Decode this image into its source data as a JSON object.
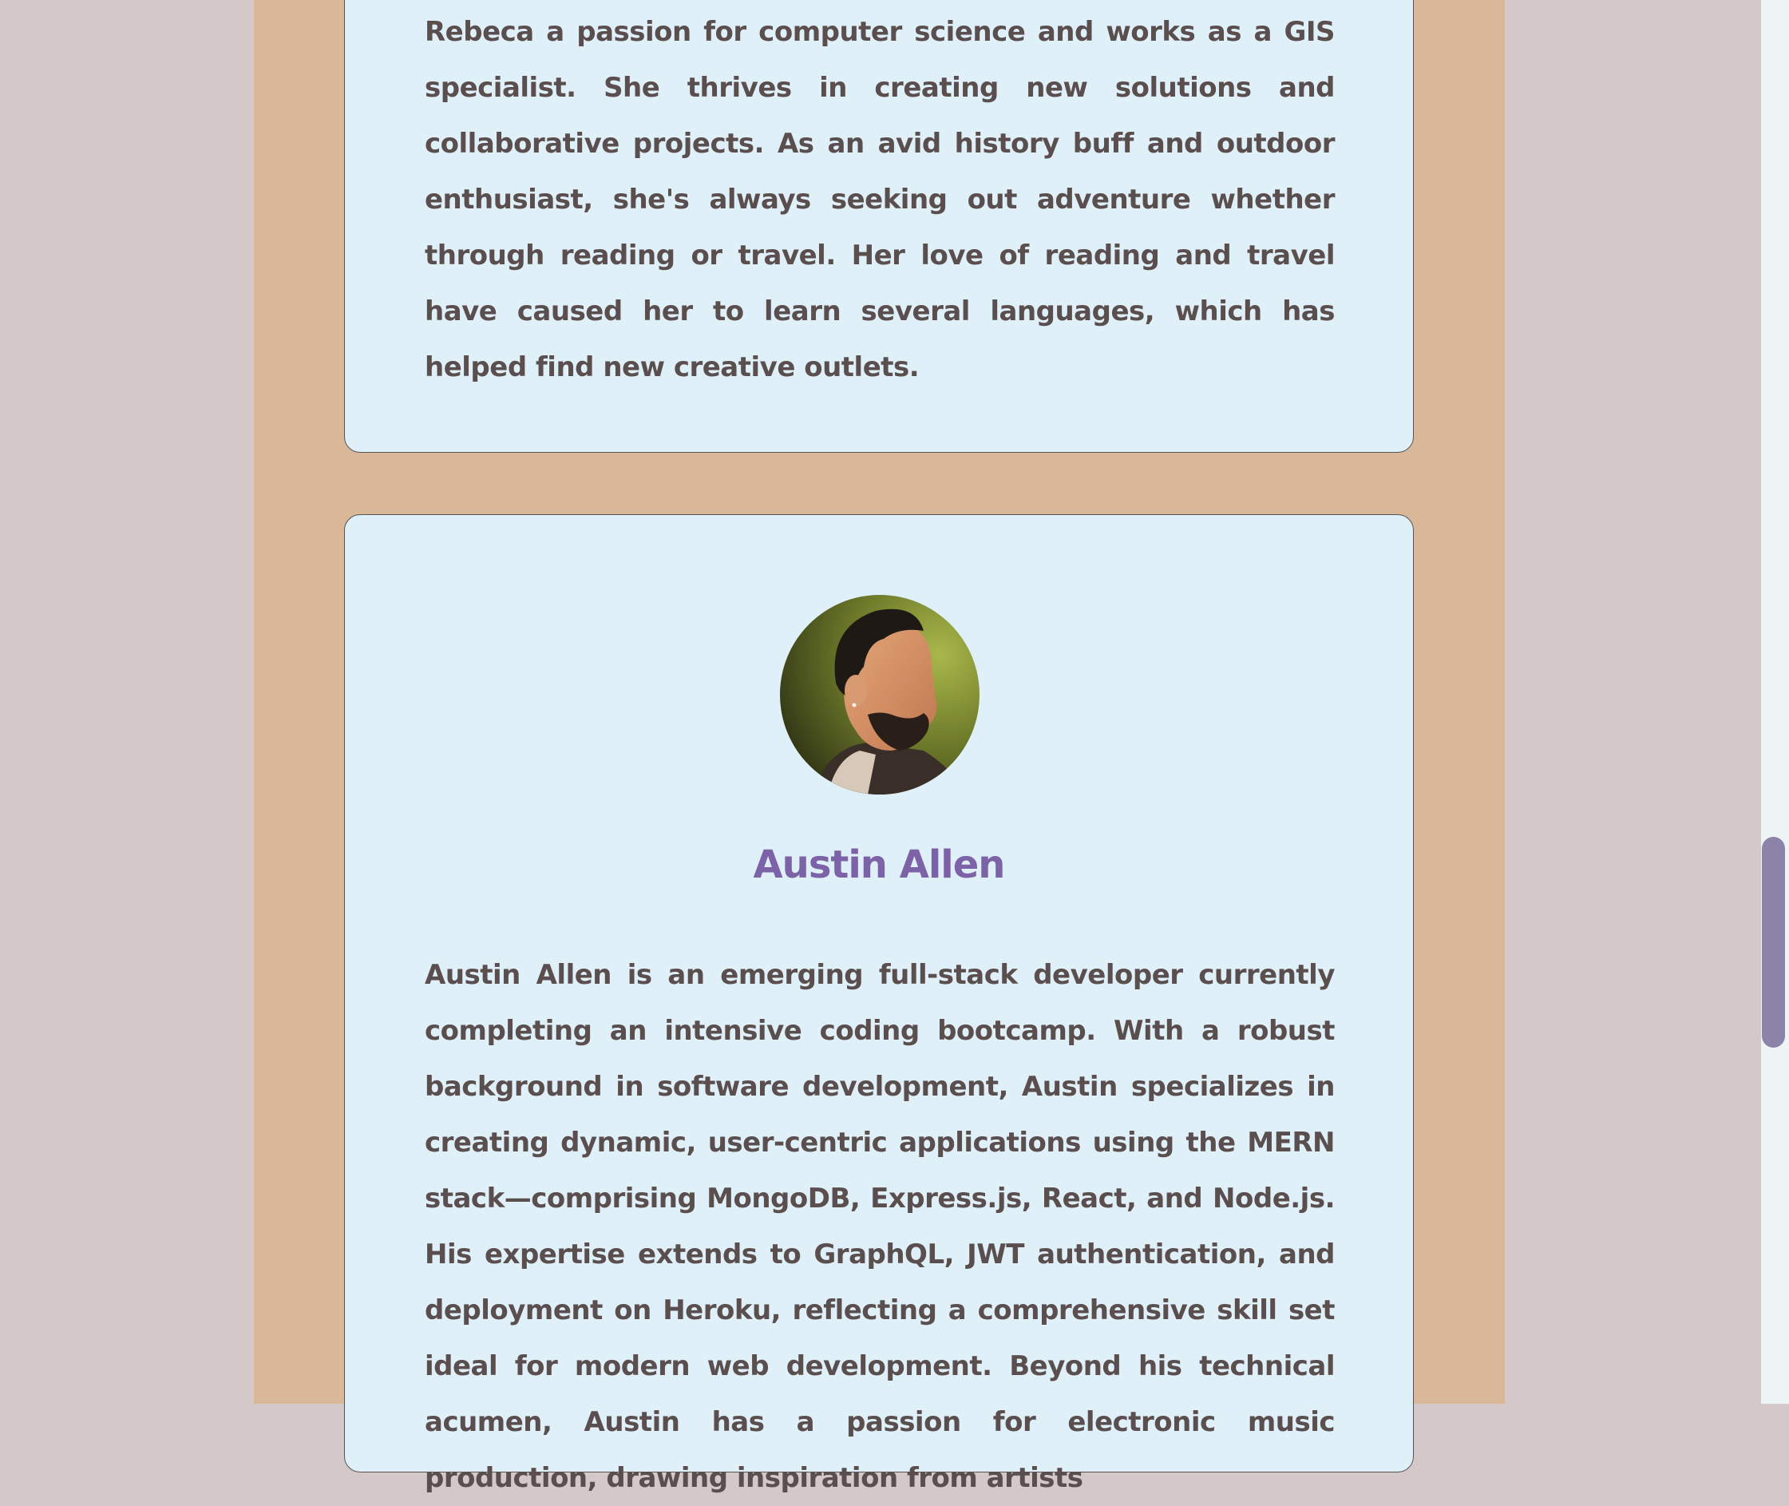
{
  "profiles": [
    {
      "bio": "Rebeca a passion for computer science and works as a GIS specialist. She thrives in creating new solutions and collaborative projects. As an avid history buff and outdoor enthusiast, she's always seeking out adventure whether through reading or travel. Her love of reading and travel have caused her to learn several languages, which has helped find new creative outlets."
    },
    {
      "name": "Austin Allen",
      "bio": "Austin Allen is an emerging full-stack developer currently completing an intensive coding bootcamp. With a robust background in software development, Austin specializes in creating dynamic, user-centric applications using the MERN stack—comprising MongoDB, Express.js, React, and Node.js. His expertise extends to GraphQL, JWT authentication, and deployment on Heroku, reflecting a comprehensive skill set ideal for modern web development. Beyond his technical acumen, Austin has a passion for electronic music production, drawing inspiration from artists"
    }
  ],
  "colors": {
    "page_background": "#d4c9c8",
    "column_background": "#d9b899",
    "card_background": "#e0f0f8",
    "name_color": "#7c62a6",
    "text_color": "#5a4e4e",
    "scrollbar_thumb": "#8c84a8"
  }
}
